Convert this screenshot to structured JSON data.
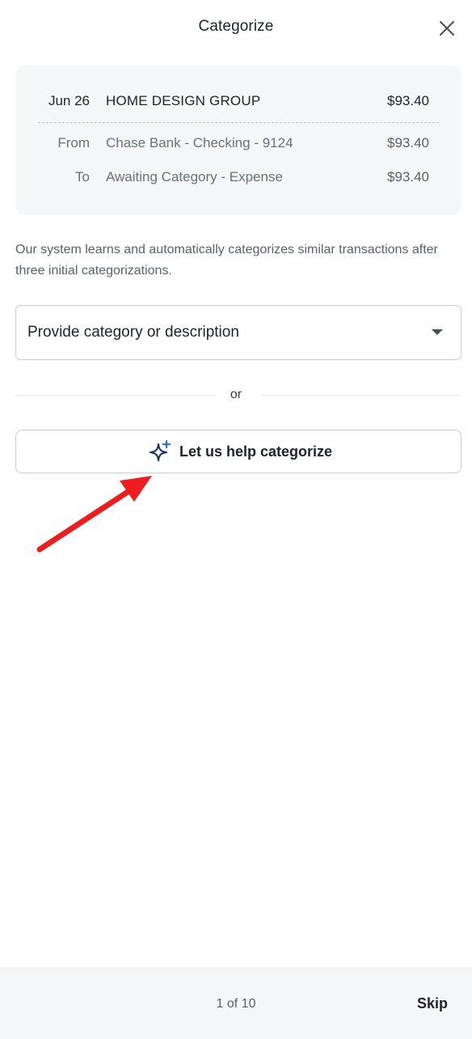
{
  "header": {
    "title": "Categorize",
    "close_icon": "close-icon"
  },
  "transaction": {
    "date": "Jun 26",
    "merchant": "HOME DESIGN GROUP",
    "amount": "$93.40",
    "from": {
      "label": "From",
      "account": "Chase Bank - Checking - 9124",
      "amount": "$93.40"
    },
    "to": {
      "label": "To",
      "account": "Awaiting Category - Expense",
      "amount": "$93.40"
    }
  },
  "info_text": "Our system learns and automatically categorizes similar transactions after three initial categorizations.",
  "category_select": {
    "placeholder": "Provide category or description",
    "icon": "caret-down-icon"
  },
  "separator_text": "or",
  "help_button": {
    "label": "Let us help categorize",
    "icon": "sparkle-icon"
  },
  "annotation": {
    "icon": "red-arrow-icon",
    "color": "#ee1c1c"
  },
  "footer": {
    "pager": "1 of 10",
    "skip_label": "Skip"
  },
  "colors": {
    "card_bg": "#f5f6f8",
    "sparkle_primary": "#1f3a5f",
    "sparkle_accent": "#2f6fd6"
  }
}
